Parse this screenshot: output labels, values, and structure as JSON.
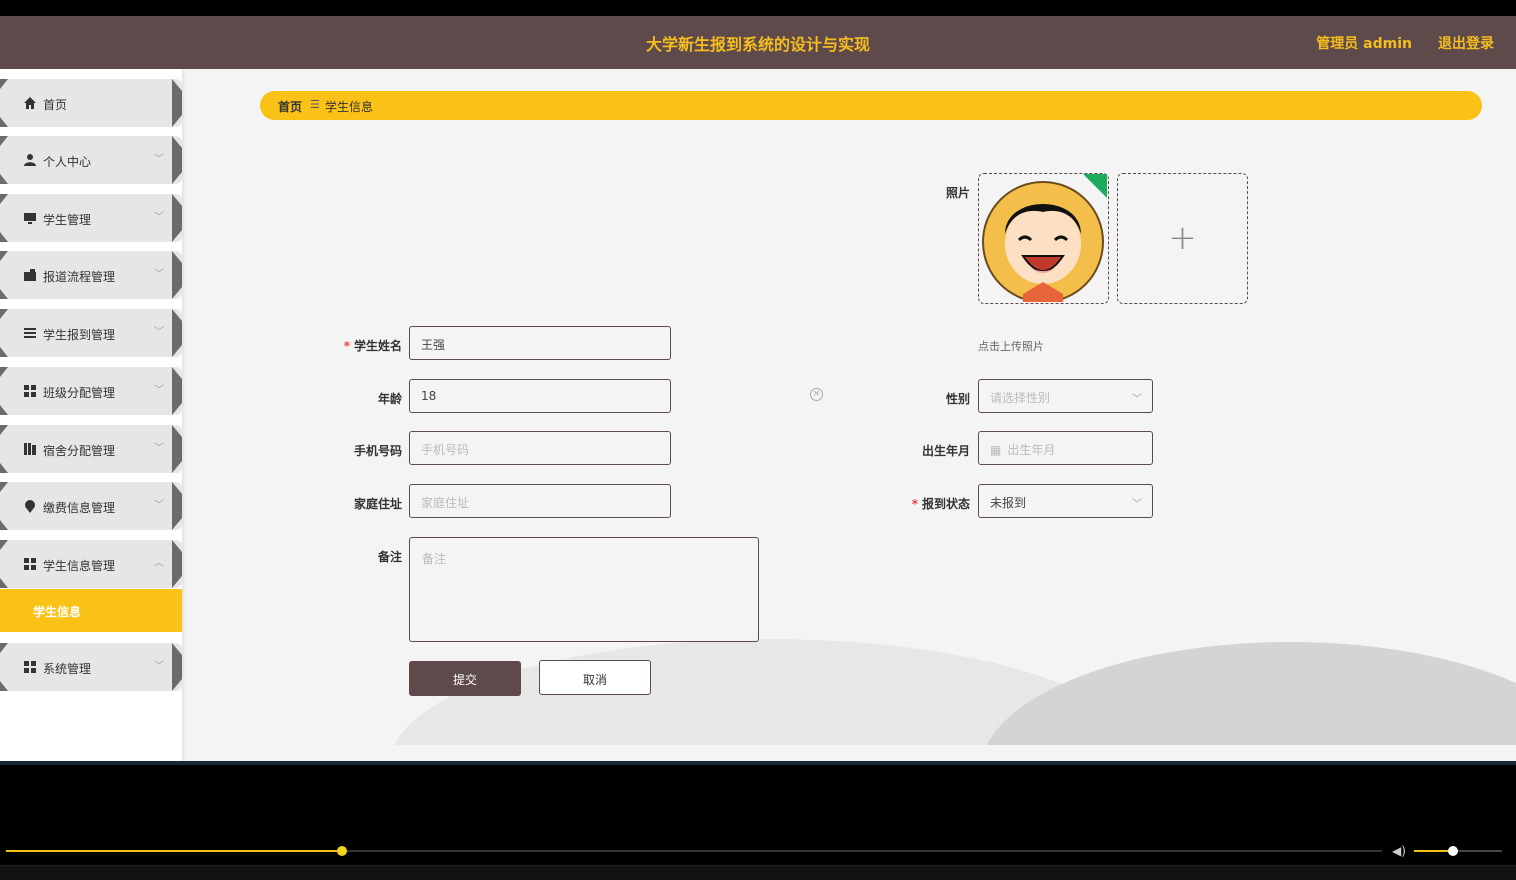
{
  "header": {
    "title": "大学新生报到系统的设计与实现",
    "admin_label": "管理员 admin",
    "logout_label": "退出登录"
  },
  "sidebar": {
    "items": [
      {
        "label": "首页",
        "icon": "home-icon"
      },
      {
        "label": "个人中心",
        "icon": "user-icon"
      },
      {
        "label": "学生管理",
        "icon": "monitor-icon"
      },
      {
        "label": "报道流程管理",
        "icon": "wallet-icon"
      },
      {
        "label": "学生报到管理",
        "icon": "list-icon"
      },
      {
        "label": "班级分配管理",
        "icon": "grid-icon"
      },
      {
        "label": "宿舍分配管理",
        "icon": "book-icon"
      },
      {
        "label": "缴费信息管理",
        "icon": "pin-icon"
      },
      {
        "label": "学生信息管理",
        "icon": "grid-icon"
      },
      {
        "label": "系统管理",
        "icon": "grid-icon"
      }
    ],
    "sub_item": "学生信息"
  },
  "breadcrumb": {
    "home": "首页",
    "separator": "☰",
    "current": "学生信息"
  },
  "form": {
    "photo_label": "照片",
    "photo_tip": "点击上传照片",
    "name_label": "学生姓名",
    "name_value": "王强",
    "age_label": "年龄",
    "age_value": "18",
    "phone_label": "手机号码",
    "phone_placeholder": "手机号码",
    "address_label": "家庭住址",
    "address_placeholder": "家庭住址",
    "notes_label": "备注",
    "notes_placeholder": "备注",
    "gender_label": "性别",
    "gender_placeholder": "请选择性别",
    "birth_label": "出生年月",
    "birth_placeholder": "出生年月",
    "status_label": "报到状态",
    "status_value": "未报到",
    "submit_label": "提交",
    "cancel_label": "取消"
  },
  "colors": {
    "header_bg": "#5e4a4a",
    "accent": "#fac216",
    "title": "#f5bd1f"
  },
  "player": {
    "progress": 0.244,
    "volume": 0.45
  }
}
